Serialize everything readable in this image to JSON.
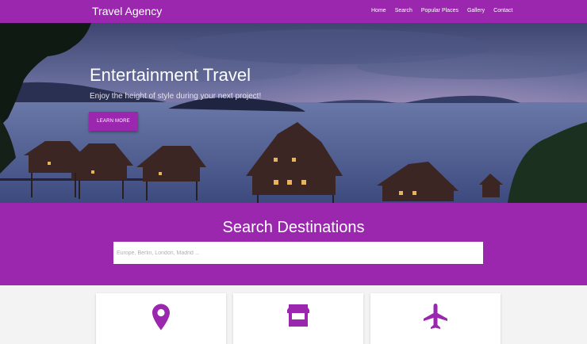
{
  "navbar": {
    "brand": "Travel Agency",
    "links": [
      "Home",
      "Search",
      "Popular Places",
      "Gallery",
      "Contact"
    ]
  },
  "hero": {
    "title": "Entertainment Travel",
    "subtitle": "Enjoy the height of style during your next project!",
    "button_label": "LEARN MORE"
  },
  "search": {
    "title": "Search Destinations",
    "placeholder": "Europe, Berlin, London, Madrid ..."
  },
  "features": [
    {
      "icon": "location-pin-icon"
    },
    {
      "icon": "store-icon"
    },
    {
      "icon": "airplane-icon"
    }
  ],
  "colors": {
    "primary": "#9b27af",
    "background": "#f3f3f3"
  }
}
